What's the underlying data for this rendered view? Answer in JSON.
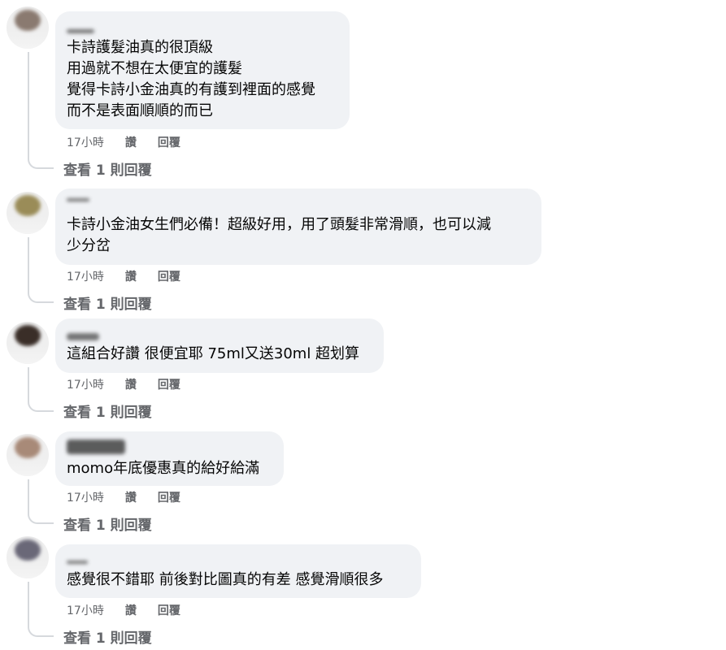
{
  "comments": [
    {
      "text": "卡詩護髮油真的很頂級\n用過就不想在太便宜的護髮\n覺得卡詩小金油真的有護到裡面的感覺\n而不是表面順順的而已",
      "time": "17小時",
      "like": "讚",
      "reply": "回覆",
      "view_replies": "查看 1 則回覆",
      "avatar_color": "#8a7a70"
    },
    {
      "text": "卡詩小金油女生們必備！超級好用，用了頭髮非常滑順，也可以減\n少分岔",
      "time": "17小時",
      "like": "讚",
      "reply": "回覆",
      "view_replies": "查看 1 則回覆",
      "avatar_color": "#9a8c58"
    },
    {
      "text": "這組合好讚 很便宜耶 75ml又送30ml 超划算",
      "time": "17小時",
      "like": "讚",
      "reply": "回覆",
      "view_replies": "查看 1 則回覆",
      "avatar_color": "#3a2e28"
    },
    {
      "text": "momo年底優惠真的給好給滿",
      "time": "17小時",
      "like": "讚",
      "reply": "回覆",
      "view_replies": "查看 1 則回覆",
      "avatar_color": "#a88a78"
    },
    {
      "text": "感覺很不錯耶 前後對比圖真的有差 感覺滑順很多",
      "time": "17小時",
      "like": "讚",
      "reply": "回覆",
      "view_replies": "查看 1 則回覆",
      "avatar_color": "#6a6878"
    }
  ]
}
